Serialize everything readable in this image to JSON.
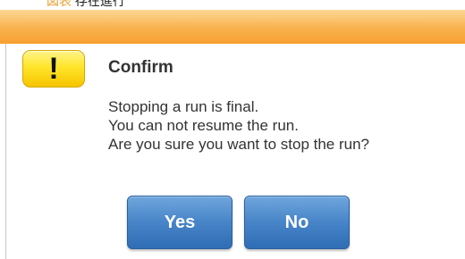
{
  "top_strip": {
    "link_text": "図表",
    "text": "存在進行"
  },
  "dialog": {
    "icon": "warning-exclamation-icon",
    "icon_glyph": "!",
    "title": "Confirm",
    "message_lines": [
      "Stopping a run is final.",
      "You can not resume the run.",
      "Are you sure you want to stop the run?"
    ],
    "buttons": {
      "yes": "Yes",
      "no": "No"
    }
  },
  "colors": {
    "title_bar": "#f9b14c",
    "button": "#4784c8",
    "icon_background": "#ffe52a"
  }
}
